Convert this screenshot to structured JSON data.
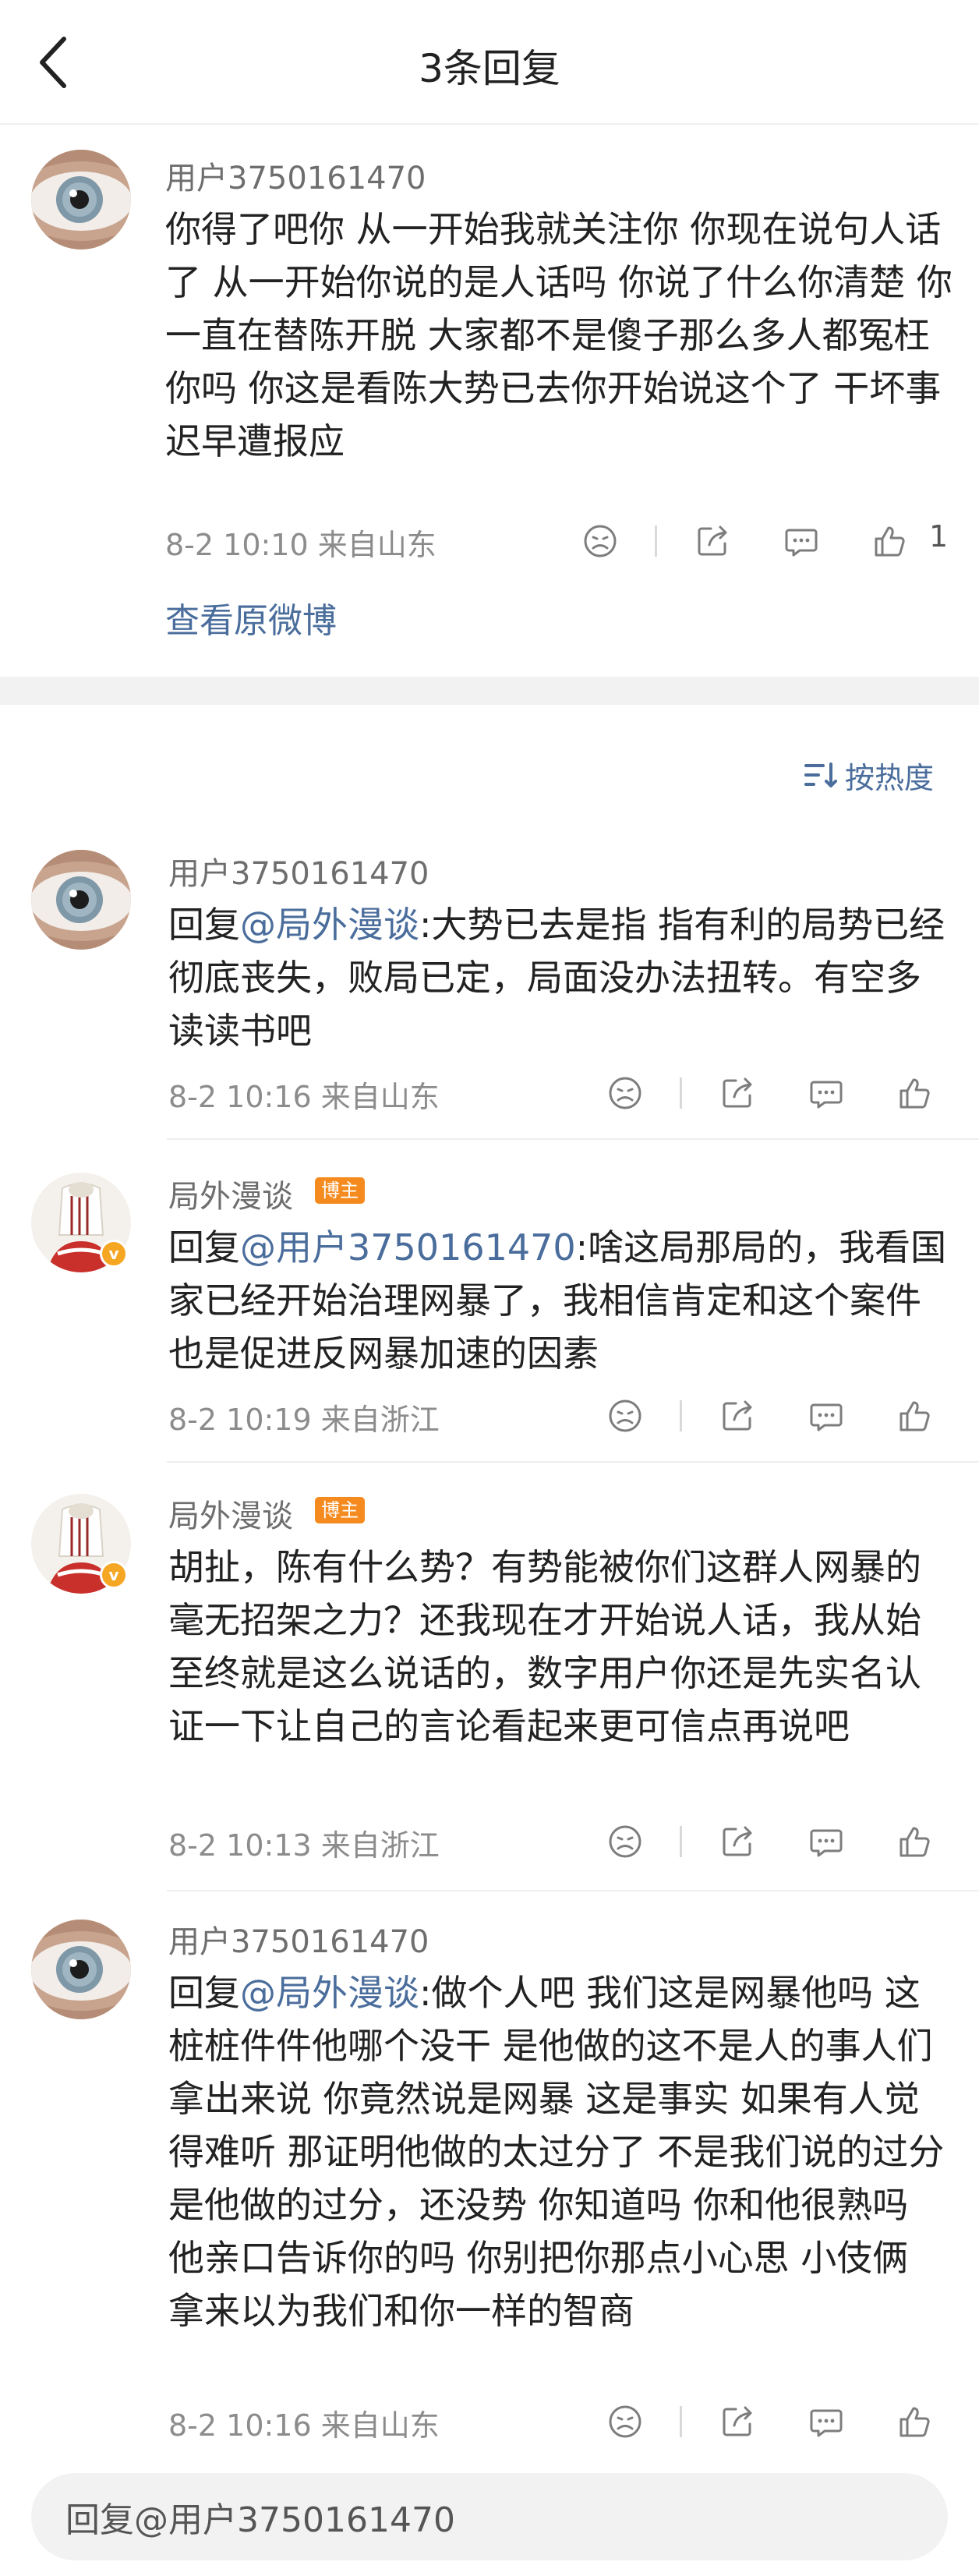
{
  "header": {
    "title": "3条回复"
  },
  "main_comment": {
    "username": "用户3750161470",
    "text": "你得了吧你 从一开始我就关注你 你现在说句人话了 从一开始你说的是人话吗 你说了什么你清楚 你一直在替陈开脱 大家都不是傻子那么多人都冤枉你吗 你这是看陈大势已去你开始说这个了 干坏事迟早遭报应",
    "meta": "8-2 10:10 来自山东",
    "like_count": "1",
    "view_original": "查看原微博"
  },
  "sort": {
    "label": "按热度"
  },
  "replies": [
    {
      "username": "用户3750161470",
      "prefix": "回复",
      "mention": "@局外漫谈",
      "text": ":大势已去是指 指有利的局势已经彻底丧失，败局已定，局面没办法扭转。有空多读读书吧",
      "meta": "8-2 10:16 来自山东"
    },
    {
      "username": "局外漫谈",
      "badge": "博主",
      "prefix": "回复",
      "mention": "@用户3750161470",
      "text": ":啥这局那局的，我看国家已经开始治理网暴了，我相信肯定和这个案件也是促进反网暴加速的因素",
      "meta": "8-2 10:19 来自浙江"
    },
    {
      "username": "局外漫谈",
      "badge": "博主",
      "text": "胡扯，陈有什么势？有势能被你们这群人网暴的毫无招架之力？还我现在才开始说人话，我从始至终就是这么说话的，数字用户你还是先实名认证一下让自己的言论看起来更可信点再说吧",
      "meta": "8-2 10:13 来自浙江"
    },
    {
      "username": "用户3750161470",
      "prefix": "回复",
      "mention": "@局外漫谈",
      "text": ":做个人吧 我们这是网暴他吗 这桩桩件件他哪个没干 是他做的这不是人的事人们拿出来说 你竟然说是网暴 这是事实 如果有人觉得难听 那证明他做的太过分了 不是我们说的过分 是他做的过分，还没势 你知道吗 你和他很熟吗  他亲口告诉你的吗  你别把你那点小心思 小伎俩 拿来以为我们和你一样的智商",
      "meta": "8-2 10:16 来自山东"
    }
  ],
  "reply_box": {
    "placeholder": "回复@用户3750161470"
  }
}
